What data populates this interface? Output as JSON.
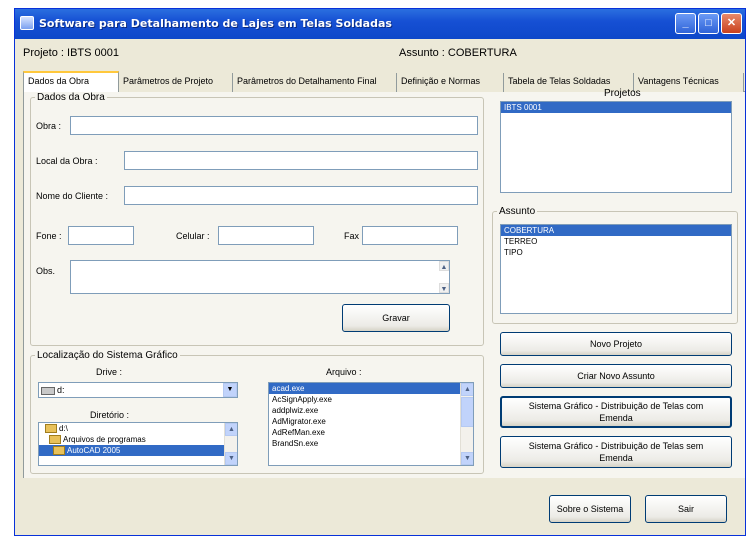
{
  "window": {
    "title": "Software para Detalhamento de Lajes em Telas Soldadas"
  },
  "info": {
    "projeto": "Projeto : IBTS 0001",
    "assunto": "Assunto : COBERTURA"
  },
  "tabs": [
    "Dados da Obra",
    "Parâmetros de Projeto",
    "Parâmetros do Detalhamento Final",
    "Definição e Normas",
    "Tabela de Telas Soldadas",
    "Vantagens Técnicas"
  ],
  "dados_obra": {
    "legend": "Dados da Obra",
    "obra_label": "Obra :",
    "local_label": "Local da Obra :",
    "cliente_label": "Nome do Cliente :",
    "fone_label": "Fone :",
    "celular_label": "Celular :",
    "fax_label": "Fax :",
    "obs_label": "Obs.",
    "gravar": "Gravar"
  },
  "localizacao": {
    "legend": "Localização do Sistema Gráfico",
    "drive_label": "Drive :",
    "drive_value": "d:",
    "diretorio_label": "Diretório :",
    "dirs": [
      "d:\\",
      "Arquivos de programas",
      "AutoCAD 2005"
    ],
    "arquivo_label": "Arquivo :",
    "files": [
      "acad.exe",
      "AcSignApply.exe",
      "addplwiz.exe",
      "AdMigrator.exe",
      "AdRefMan.exe",
      "BrandSn.exe"
    ]
  },
  "projetos": {
    "title": "Projetos",
    "items": [
      "IBTS 0001"
    ]
  },
  "assunto": {
    "legend": "Assunto",
    "items": [
      "COBERTURA",
      "TERREO",
      "TIPO"
    ]
  },
  "buttons": {
    "novo_projeto": "Novo Projeto",
    "criar_assunto": "Criar Novo Assunto",
    "sis_com": "Sistema Gráfico - Distribuição de Telas com Emenda",
    "sis_sem": "Sistema Gráfico - Distribuição de Telas sem Emenda",
    "sobre": "Sobre o Sistema",
    "sair": "Sair"
  }
}
